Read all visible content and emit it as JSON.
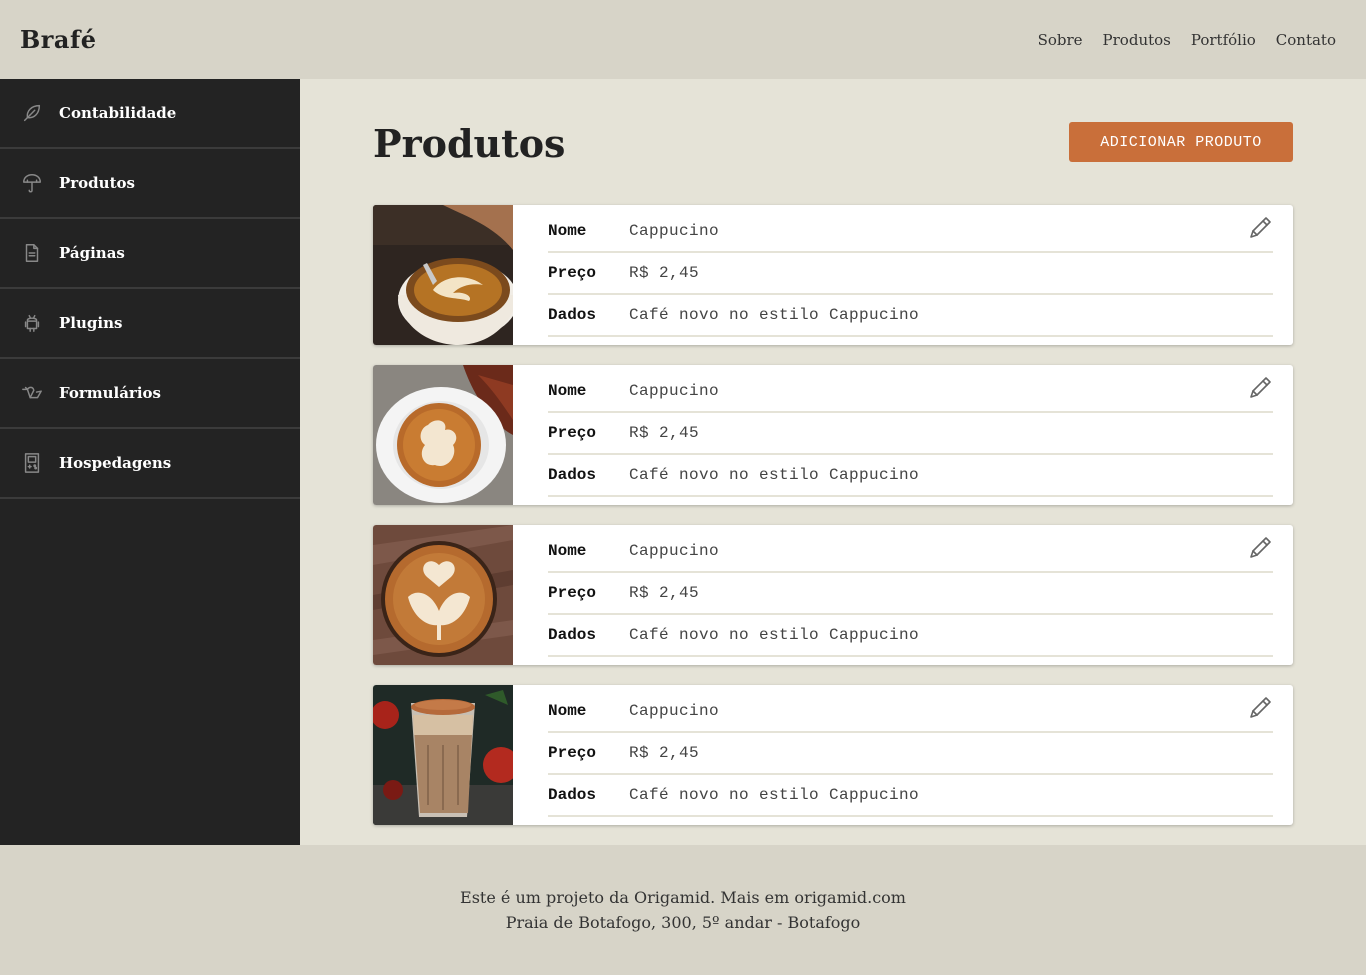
{
  "header": {
    "logo": "Brafé",
    "nav": [
      "Sobre",
      "Produtos",
      "Portfólio",
      "Contato"
    ]
  },
  "sidebar": {
    "items": [
      {
        "label": "Contabilidade",
        "icon": "leaf-icon"
      },
      {
        "label": "Produtos",
        "icon": "umbrella-icon"
      },
      {
        "label": "Páginas",
        "icon": "document-icon"
      },
      {
        "label": "Plugins",
        "icon": "android-icon"
      },
      {
        "label": "Formulários",
        "icon": "bird-icon"
      },
      {
        "label": "Hospedagens",
        "icon": "gameboy-icon"
      }
    ]
  },
  "main": {
    "title": "Produtos",
    "add_button": "ADICIONAR PRODUTO",
    "field_labels": {
      "name": "Nome",
      "price": "Preço",
      "data": "Dados"
    },
    "products": [
      {
        "name": "Cappucino",
        "price": "R$ 2,45",
        "data": "Café novo no estilo Cappucino"
      },
      {
        "name": "Cappucino",
        "price": "R$ 2,45",
        "data": "Café novo no estilo Cappucino"
      },
      {
        "name": "Cappucino",
        "price": "R$ 2,45",
        "data": "Café novo no estilo Cappucino"
      },
      {
        "name": "Cappucino",
        "price": "R$ 2,45",
        "data": "Café novo no estilo Cappucino"
      }
    ]
  },
  "footer": {
    "line1": "Este é um projeto da Origamid. Mais em origamid.com",
    "line2": "Praia de Botafogo, 300, 5º andar - Botafogo"
  },
  "colors": {
    "accent": "#c96f3a",
    "sidebar_bg": "#232323",
    "header_bg": "#d7d4c8",
    "main_bg": "#e5e3d7"
  }
}
